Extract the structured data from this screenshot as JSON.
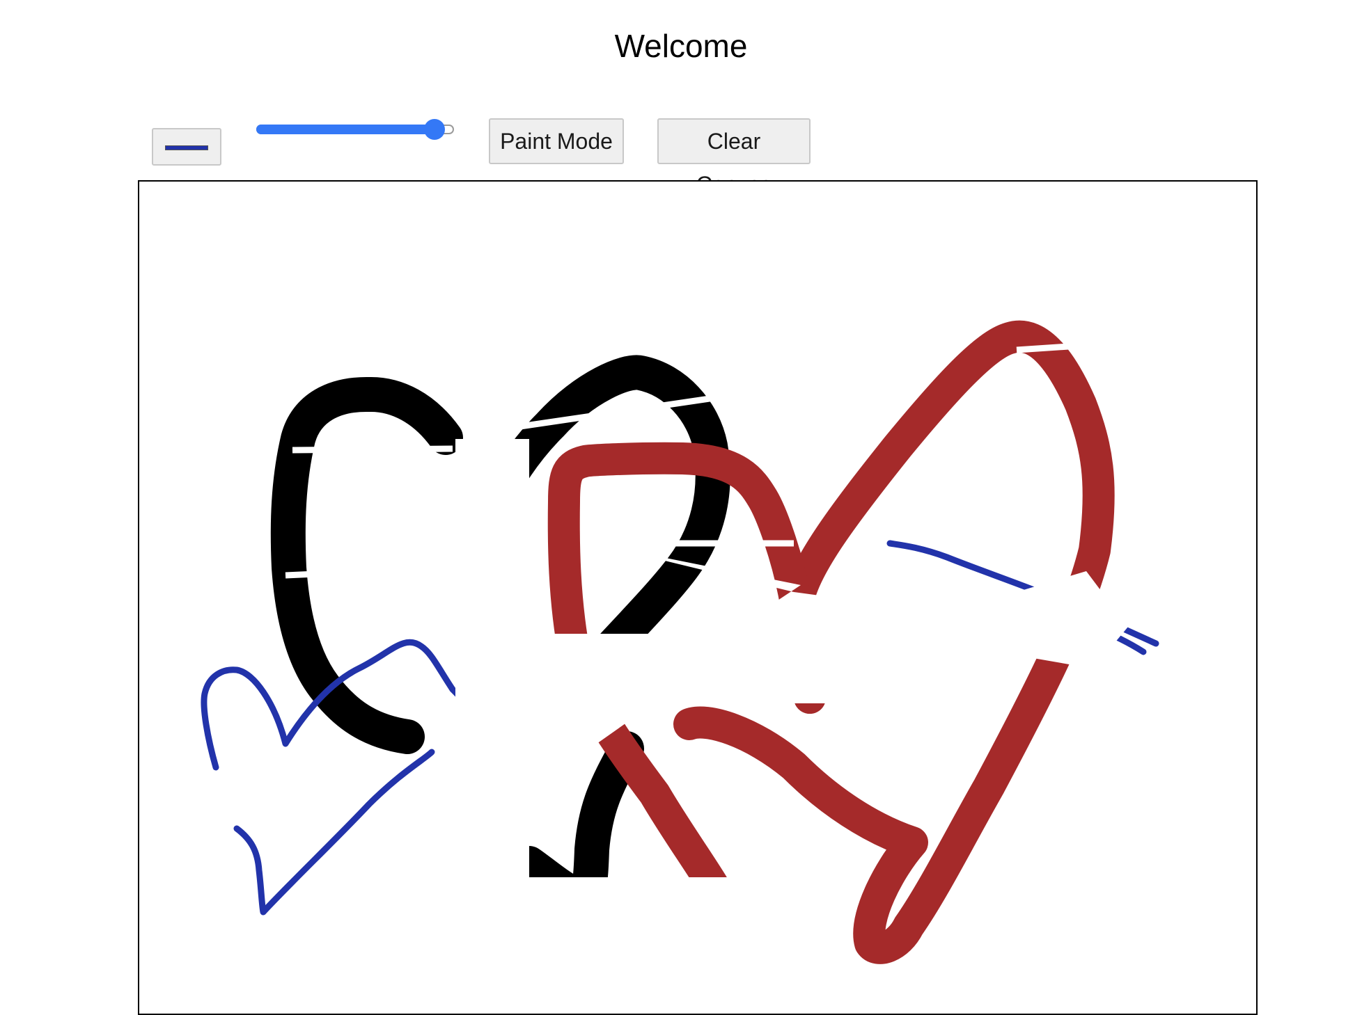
{
  "page": {
    "title": "Welcome"
  },
  "toolbar": {
    "color_picker": {
      "value": "#2233aa",
      "icon": "color-swatch"
    },
    "brush_size": {
      "min": 0,
      "max": 100,
      "value": 90,
      "accent_color": "#3478f6"
    },
    "paint_mode_label": "Paint Mode",
    "clear_canvas_label": "Clear Canvas"
  },
  "canvas": {
    "background": "#ffffff",
    "stroke_colors": {
      "black": "#000000",
      "red": "#a52a2a",
      "blue": "#2233aa"
    }
  }
}
